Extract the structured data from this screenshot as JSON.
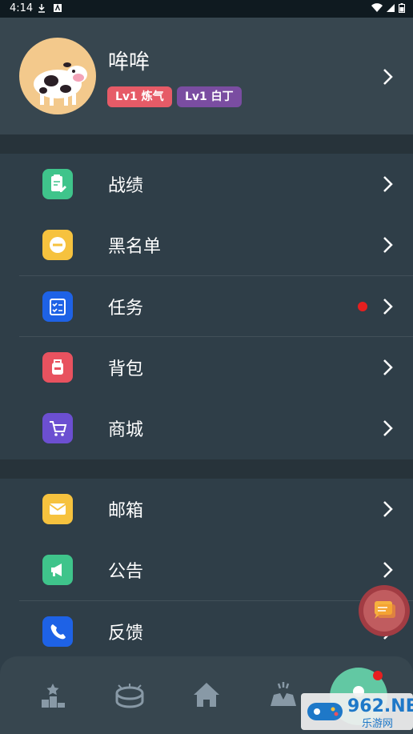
{
  "status_bar": {
    "time": "4:14"
  },
  "profile": {
    "name": "哞哞",
    "badges": [
      "Lv1 炼气",
      "Lv1 白丁"
    ]
  },
  "menu_group_1": [
    {
      "label": "战绩",
      "icon": "edit-clipboard-icon",
      "color": "#3fc48b"
    },
    {
      "label": "黑名单",
      "icon": "minus-circle-icon",
      "color": "#f6c23e"
    },
    {
      "label": "任务",
      "icon": "task-checklist-icon",
      "color": "#1e62e6",
      "has_dot": true
    },
    {
      "label": "背包",
      "icon": "backpack-icon",
      "color": "#e8525f"
    },
    {
      "label": "商城",
      "icon": "cart-icon",
      "color": "#6c4fd1"
    }
  ],
  "menu_group_2": [
    {
      "label": "邮箱",
      "icon": "mail-icon",
      "color": "#f6c23e"
    },
    {
      "label": "公告",
      "icon": "megaphone-icon",
      "color": "#3fc48b"
    },
    {
      "label": "反馈",
      "icon": "phone-icon",
      "color": "#1e62e6"
    }
  ],
  "tabbar": {
    "tabs": [
      "ranking-icon",
      "stadium-icon",
      "home-icon",
      "friends-icon",
      "profile-icon"
    ]
  },
  "watermark": {
    "main": "962.NET",
    "sub": "乐游网"
  },
  "colors": {
    "background": "#2f3e48",
    "card": "#37464f",
    "accent_red": "#e61f1f"
  }
}
